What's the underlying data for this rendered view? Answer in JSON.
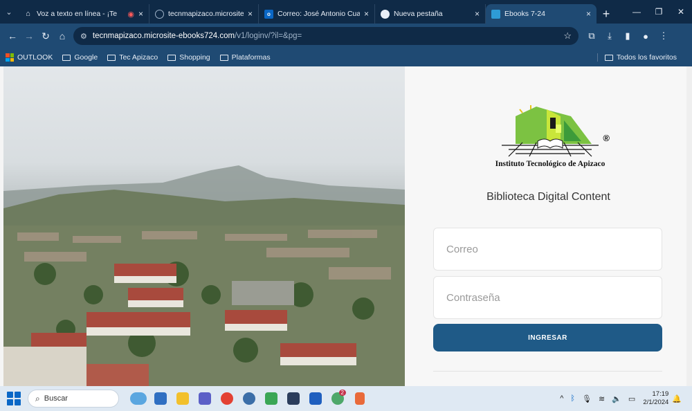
{
  "browser": {
    "tabs": [
      {
        "title": "Voz a texto en línea - ¡Te",
        "favicon": "home-icon",
        "color": "#e8eef6",
        "active": false
      },
      {
        "title": "tecnmapizaco.microsite-ebo",
        "favicon": "globe-icon",
        "color": "#9fb3c8",
        "active": false
      },
      {
        "title": "Correo: José Antonio Cuatep",
        "favicon": "outlook-icon",
        "color": "#0a67c6",
        "active": false
      },
      {
        "title": "Nueva pestaña",
        "favicon": "chrome-icon",
        "color": "#e8eef6",
        "active": false
      },
      {
        "title": "Ebooks 7-24",
        "favicon": "ebooks-icon",
        "color": "#2e9bd6",
        "active": true
      }
    ],
    "new_tab_label": "+",
    "url_host": "tecnmapizaco.microsite-ebooks724.com",
    "url_path": "/v1/loginv/?il=&pg=",
    "bookmarks": [
      {
        "label": "OUTLOOK",
        "icon": "microsoft-icon"
      },
      {
        "label": "Google",
        "icon": "folder-icon"
      },
      {
        "label": "Tec Apizaco",
        "icon": "folder-icon"
      },
      {
        "label": "Shopping",
        "icon": "folder-icon"
      },
      {
        "label": "Plataformas",
        "icon": "folder-icon"
      }
    ],
    "all_bookmarks": "Todos los favoritos"
  },
  "login": {
    "logo_text": "Instituto Tecnológico de Apizaco",
    "logo_registered": "®",
    "title": "Biblioteca Digital Content",
    "email_placeholder": "Correo",
    "password_placeholder": "Contraseña",
    "submit_label": "INGRESAR",
    "accent_color": "#1f5a87"
  },
  "taskbar": {
    "search_placeholder": "Buscar",
    "time": "17:19",
    "date": "2/1/2024",
    "teams_badge": "2"
  }
}
